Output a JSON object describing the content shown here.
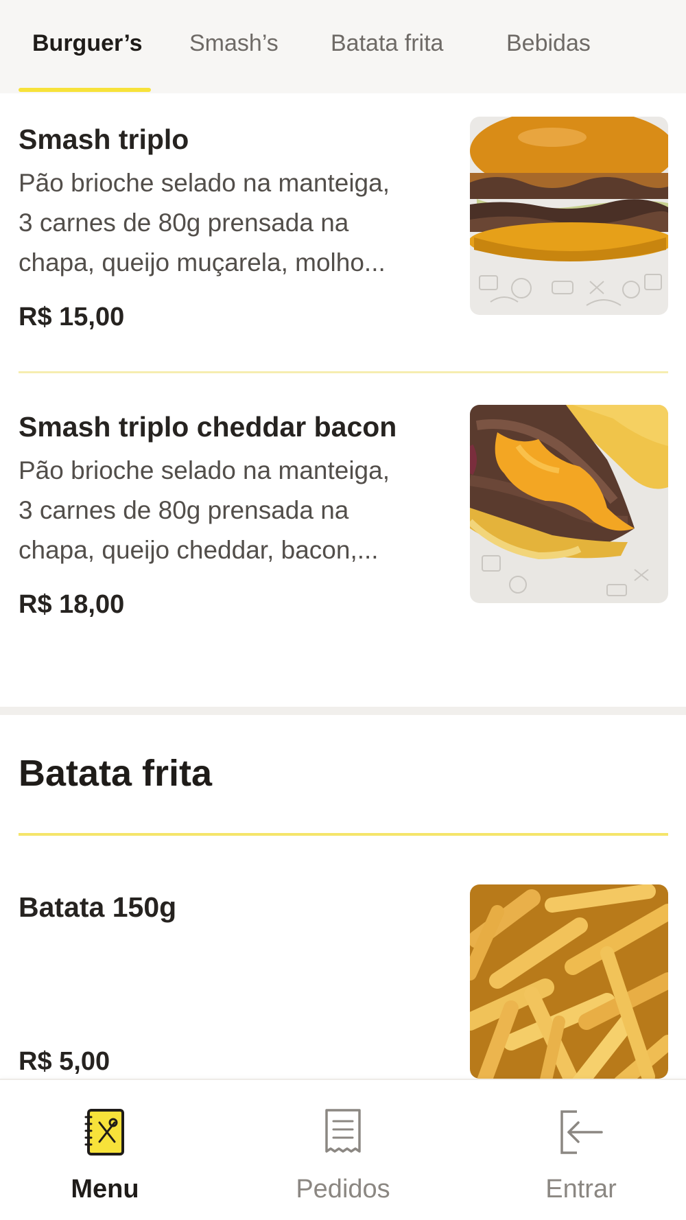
{
  "tabs": [
    {
      "label": "Burguer’s",
      "active": true
    },
    {
      "label": "Smash’s",
      "active": false
    },
    {
      "label": "Batata frita",
      "active": false
    },
    {
      "label": "Bebidas",
      "active": false
    }
  ],
  "items": [
    {
      "title": "Smash triplo",
      "description_lines": [
        "Pão brioche selado na manteiga,",
        "3 carnes de 80g prensada na",
        "chapa, queijo muçarela, molho..."
      ],
      "price": "R$ 15,00",
      "photo_icon": "burger-photo"
    },
    {
      "title": "Smash triplo cheddar bacon",
      "description_lines": [
        "Pão brioche selado na manteiga,",
        "3 carnes de 80g prensada na",
        "chapa, queijo cheddar, bacon,..."
      ],
      "price": "R$ 18,00",
      "photo_icon": "cheddar-burger-photo"
    }
  ],
  "section": {
    "title": "Batata frita",
    "items": [
      {
        "title": "Batata 150g",
        "price": "R$ 5,00",
        "photo_icon": "fries-photo"
      }
    ]
  },
  "bottom_nav": [
    {
      "label": "Menu",
      "icon": "menu-book-icon",
      "active": true
    },
    {
      "label": "Pedidos",
      "icon": "receipt-icon",
      "active": false
    },
    {
      "label": "Entrar",
      "icon": "login-icon",
      "active": false
    }
  ],
  "colors": {
    "accent": "#f7e23a",
    "text": "#262320",
    "muted": "#8b8782"
  }
}
